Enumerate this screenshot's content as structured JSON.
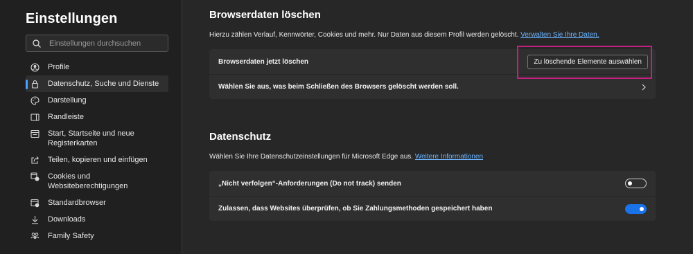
{
  "sidebar": {
    "title": "Einstellungen",
    "search": {
      "placeholder": "Einstellungen durchsuchen"
    },
    "items": [
      {
        "label": "Profile",
        "icon": "profile-icon",
        "active": false
      },
      {
        "label": "Datenschutz, Suche und Dienste",
        "icon": "lock-icon",
        "active": true
      },
      {
        "label": "Darstellung",
        "icon": "appearance-icon",
        "active": false
      },
      {
        "label": "Randleiste",
        "icon": "sidebar-icon",
        "active": false
      },
      {
        "label": "Start, Startseite und neue Registerkarten",
        "icon": "start-page-icon",
        "active": false
      },
      {
        "label": "Teilen, kopieren und einfügen",
        "icon": "share-icon",
        "active": false
      },
      {
        "label": "Cookies und Websiteberechtigungen",
        "icon": "cookies-icon",
        "active": false
      },
      {
        "label": "Standardbrowser",
        "icon": "default-browser-icon",
        "active": false
      },
      {
        "label": "Downloads",
        "icon": "download-icon",
        "active": false
      },
      {
        "label": "Family Safety",
        "icon": "family-icon",
        "active": false
      }
    ]
  },
  "clear_data": {
    "title": "Browserdaten löschen",
    "description": "Hierzu zählen Verlauf, Kennwörter, Cookies und mehr. Nur Daten aus diesem Profil werden gelöscht.",
    "link": "Verwalten Sie Ihre Daten.",
    "row1_label": "Browserdaten jetzt löschen",
    "row1_button": "Zu löschende Elemente auswählen",
    "row2_label": "Wählen Sie aus, was beim Schließen des Browsers gelöscht werden soll."
  },
  "privacy": {
    "title": "Datenschutz",
    "description": "Wählen Sie Ihre Datenschutzeinstellungen für Microsoft Edge aus.",
    "link": "Weitere Informationen",
    "row1_label": "„Nicht verfolgen“-Anforderungen (Do not track) senden",
    "row1_toggle": "off",
    "row2_label": "Zulassen, dass Websites überprüfen, ob Sie Zahlungsmethoden gespeichert haben",
    "row2_toggle": "on"
  },
  "colors": {
    "accent": "#1a73e8",
    "link": "#6cb4ff",
    "highlight": "#c21f7e"
  }
}
